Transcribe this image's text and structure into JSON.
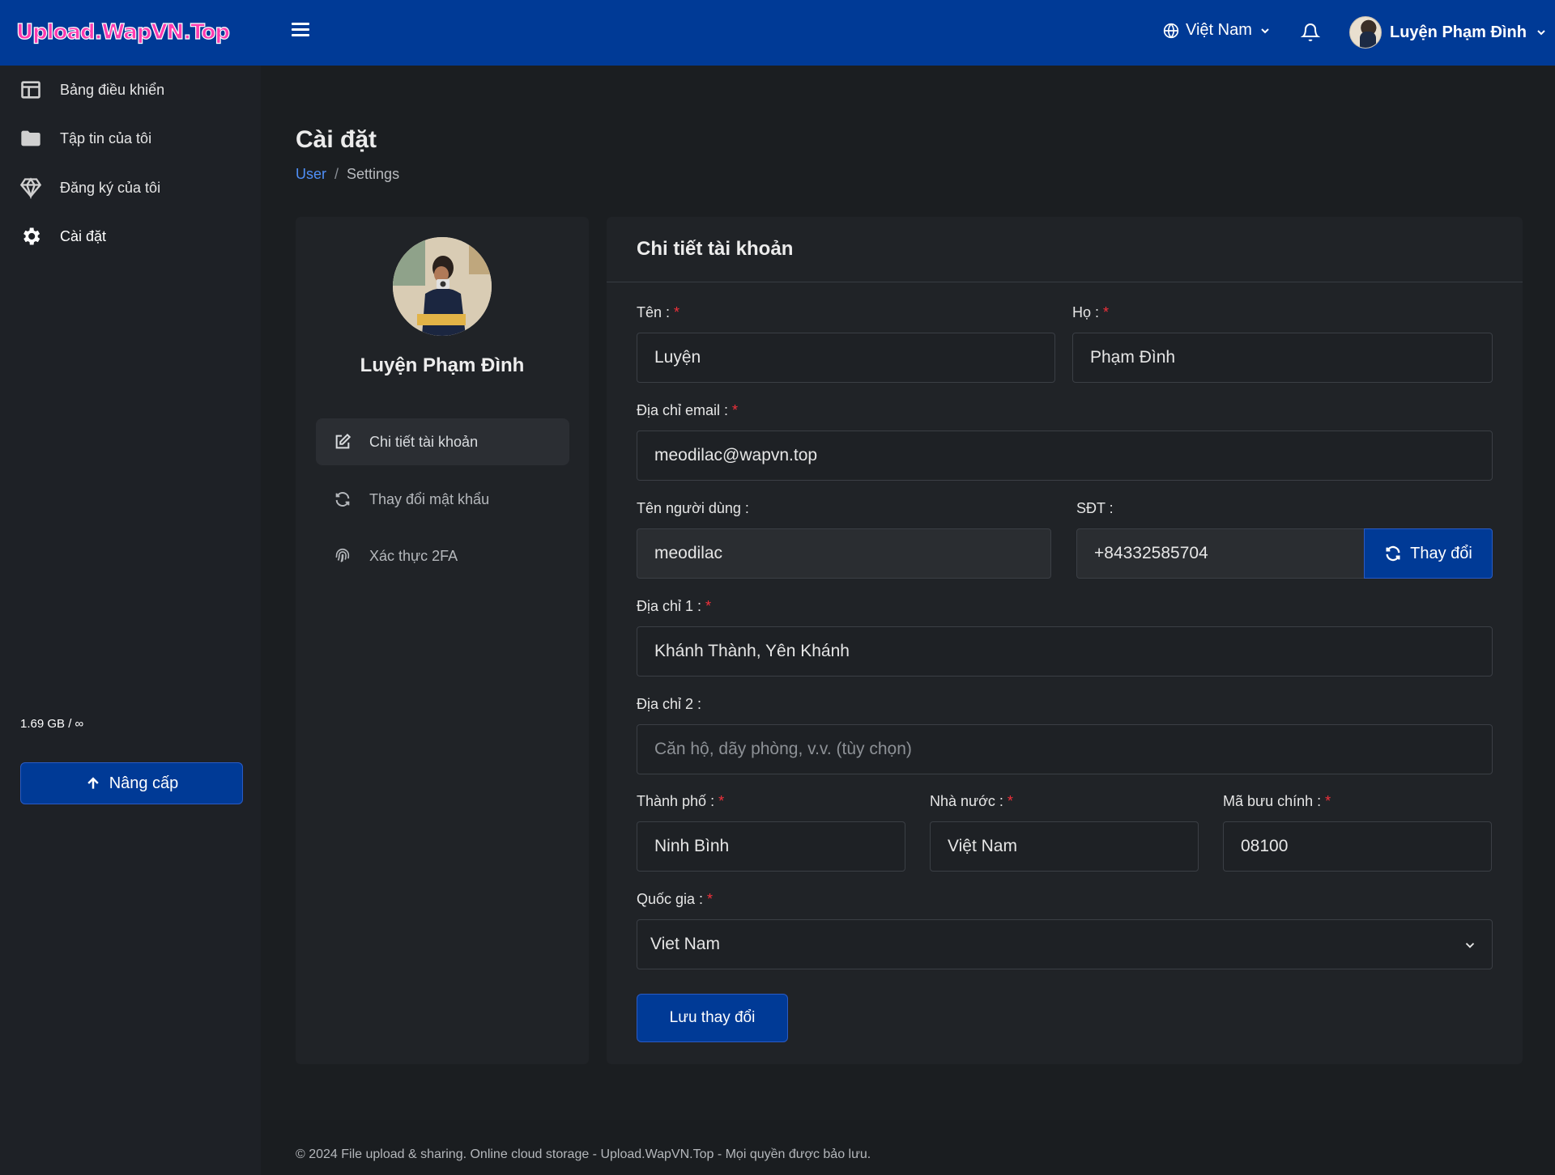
{
  "header": {
    "logo_text": "Upload.WapVN.Top",
    "language": "Việt Nam",
    "user_name": "Luyện Phạm Đình"
  },
  "sidebar": {
    "items": [
      {
        "label": "Bảng điều khiển",
        "icon": "dashboard-icon"
      },
      {
        "label": "Tập tin của tôi",
        "icon": "folder-icon"
      },
      {
        "label": "Đăng ký của tôi",
        "icon": "diamond-icon"
      },
      {
        "label": "Cài đặt",
        "icon": "gear-icon"
      }
    ],
    "storage": "1.69 GB / ∞",
    "upgrade_label": "Nâng cấp"
  },
  "page": {
    "title": "Cài đặt",
    "breadcrumb": {
      "parent": "User",
      "separator": "/",
      "current": "Settings"
    }
  },
  "profile": {
    "name": "Luyện Phạm Đình",
    "menu": [
      {
        "label": "Chi tiết tài khoản",
        "icon": "edit-icon",
        "active": true
      },
      {
        "label": "Thay đổi mật khẩu",
        "icon": "refresh-icon",
        "active": false
      },
      {
        "label": "Xác thực 2FA",
        "icon": "fingerprint-icon",
        "active": false
      }
    ]
  },
  "form": {
    "title": "Chi tiết tài khoản",
    "required_mark": "*",
    "first_name": {
      "label": "Tên :",
      "value": "Luyện"
    },
    "last_name": {
      "label": "Họ :",
      "value": "Phạm Đình"
    },
    "email": {
      "label": "Địa chỉ email :",
      "value": "meodilac@wapvn.top"
    },
    "username": {
      "label": "Tên người dùng :",
      "value": "meodilac"
    },
    "phone": {
      "label": "SĐT :",
      "value": "+84332585704",
      "button": "Thay đổi"
    },
    "address1": {
      "label": "Địa chỉ 1 :",
      "value": "Khánh Thành, Yên Khánh"
    },
    "address2": {
      "label": "Địa chỉ 2 :",
      "placeholder": "Căn hộ, dãy phòng, v.v. (tùy chọn)"
    },
    "city": {
      "label": "Thành phố :",
      "value": "Ninh Bình"
    },
    "state": {
      "label": "Nhà nước :",
      "value": "Việt Nam"
    },
    "zip": {
      "label": "Mã bưu chính :",
      "value": "08100"
    },
    "country": {
      "label": "Quốc gia :",
      "value": "Viet Nam"
    },
    "save_label": "Lưu thay đổi"
  },
  "footer": {
    "text": "© 2024 File upload & sharing. Online cloud storage - Upload.WapVN.Top - Mọi quyền được bảo lưu."
  },
  "colors": {
    "header_bg": "#003a96",
    "page_bg": "#1b1e21",
    "card_bg": "#202327",
    "link": "#4f8ff7",
    "required": "#f0303a"
  }
}
